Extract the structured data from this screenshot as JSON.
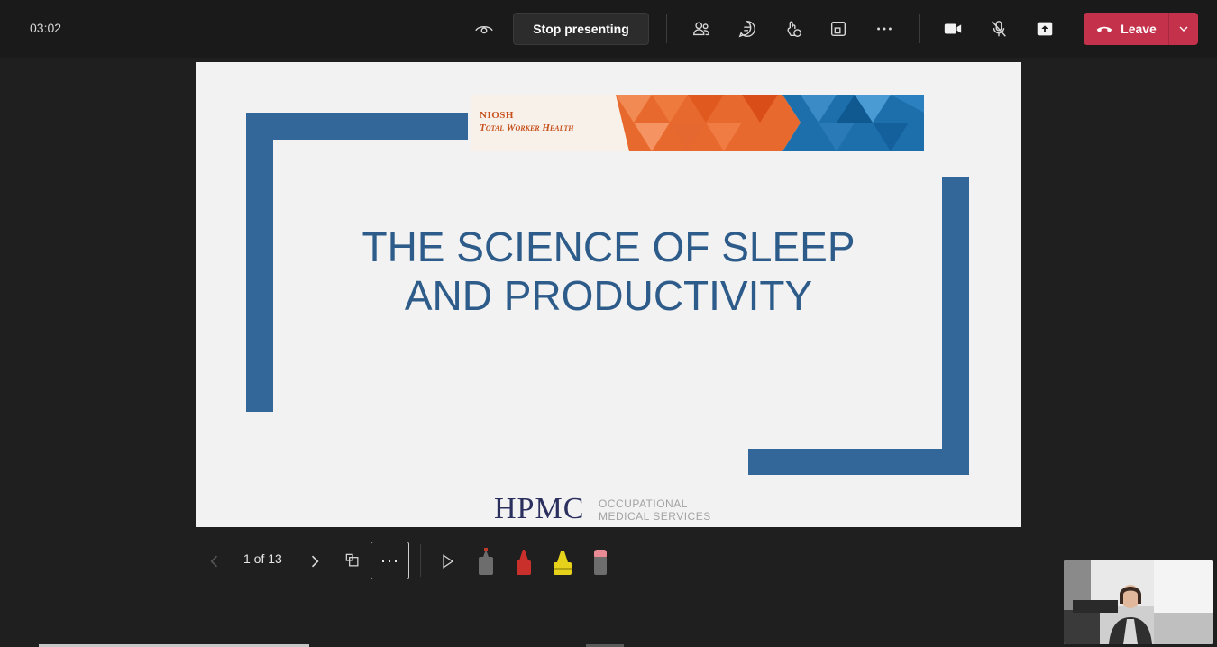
{
  "toolbar": {
    "timer": "03:02",
    "stop_presenting_label": "Stop presenting",
    "leave_label": "Leave",
    "icons": [
      "eye-icon",
      "people-icon",
      "chat-icon",
      "reactions-icon",
      "rooms-icon",
      "more-icon",
      "camera-icon",
      "mic-off-icon",
      "share-icon",
      "phone-icon",
      "chevron-down-icon"
    ],
    "leave_color": "#c4314b"
  },
  "slide": {
    "banner_org": "NIOSH",
    "banner_program": "Total Worker Health",
    "title_line1": "THE SCIENCE OF SLEEP",
    "title_line2": "AND PRODUCTIVITY",
    "footer_logo": "HPMC",
    "footer_sub_line1": "OCCUPATIONAL",
    "footer_sub_line2": "MEDICAL SERVICES",
    "accent_color": "#336699",
    "title_color": "#2e5c8a"
  },
  "slide_controls": {
    "page_indicator": "1 of 13",
    "more_label": "···",
    "tools": [
      "prev-icon",
      "next-icon",
      "slides-grid-icon",
      "more-icon",
      "pointer-icon",
      "pen-icon",
      "red-pen-icon",
      "highlighter-icon",
      "eraser-icon"
    ]
  }
}
